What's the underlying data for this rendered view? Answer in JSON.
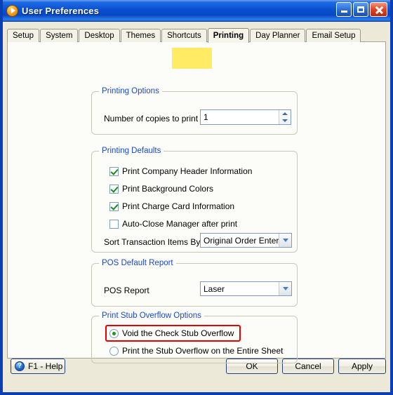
{
  "window": {
    "title": "User Preferences",
    "app_icon": "play-circle-icon",
    "controls": {
      "minimize": "Minimize",
      "maximize": "Maximize",
      "close": "Close"
    }
  },
  "tabs": [
    {
      "label": "Setup",
      "active": false
    },
    {
      "label": "System",
      "active": false
    },
    {
      "label": "Desktop",
      "active": false
    },
    {
      "label": "Themes",
      "active": false
    },
    {
      "label": "Shortcuts",
      "active": false
    },
    {
      "label": "Printing",
      "active": true
    },
    {
      "label": "Day Planner",
      "active": false
    },
    {
      "label": "Email Setup",
      "active": false
    }
  ],
  "annotations": {
    "tab_highlight_color": "#ffe94a",
    "rect_color": "#e80000",
    "highlighted_tab": "Printing",
    "highlighted_option": "Void the Check Stub Overflow"
  },
  "groups": {
    "printing_options": {
      "title": "Printing Options",
      "copies_label": "Number of copies to print",
      "copies_value": "1"
    },
    "printing_defaults": {
      "title": "Printing Defaults",
      "checkboxes": [
        {
          "label": "Print Company Header Information",
          "checked": true
        },
        {
          "label": "Print Background Colors",
          "checked": true
        },
        {
          "label": "Print Charge Card Information",
          "checked": true
        },
        {
          "label": "Auto-Close Manager after print",
          "checked": false
        }
      ],
      "sort_label": "Sort Transaction Items By",
      "sort_value": "Original Order Entered"
    },
    "pos_default_report": {
      "title": "POS Default Report",
      "report_label": "POS Report",
      "report_value": "Laser"
    },
    "print_stub_overflow": {
      "title": "Print Stub Overflow Options",
      "radios": [
        {
          "label": "Void the Check Stub Overflow",
          "selected": true
        },
        {
          "label": "Print the Stub Overflow on the Entire Sheet",
          "selected": false
        }
      ]
    }
  },
  "footer": {
    "help_label": "F1 - Help",
    "help_icon": "question-mark-icon",
    "ok_label": "OK",
    "cancel_label": "Cancel",
    "apply_label": "Apply"
  }
}
